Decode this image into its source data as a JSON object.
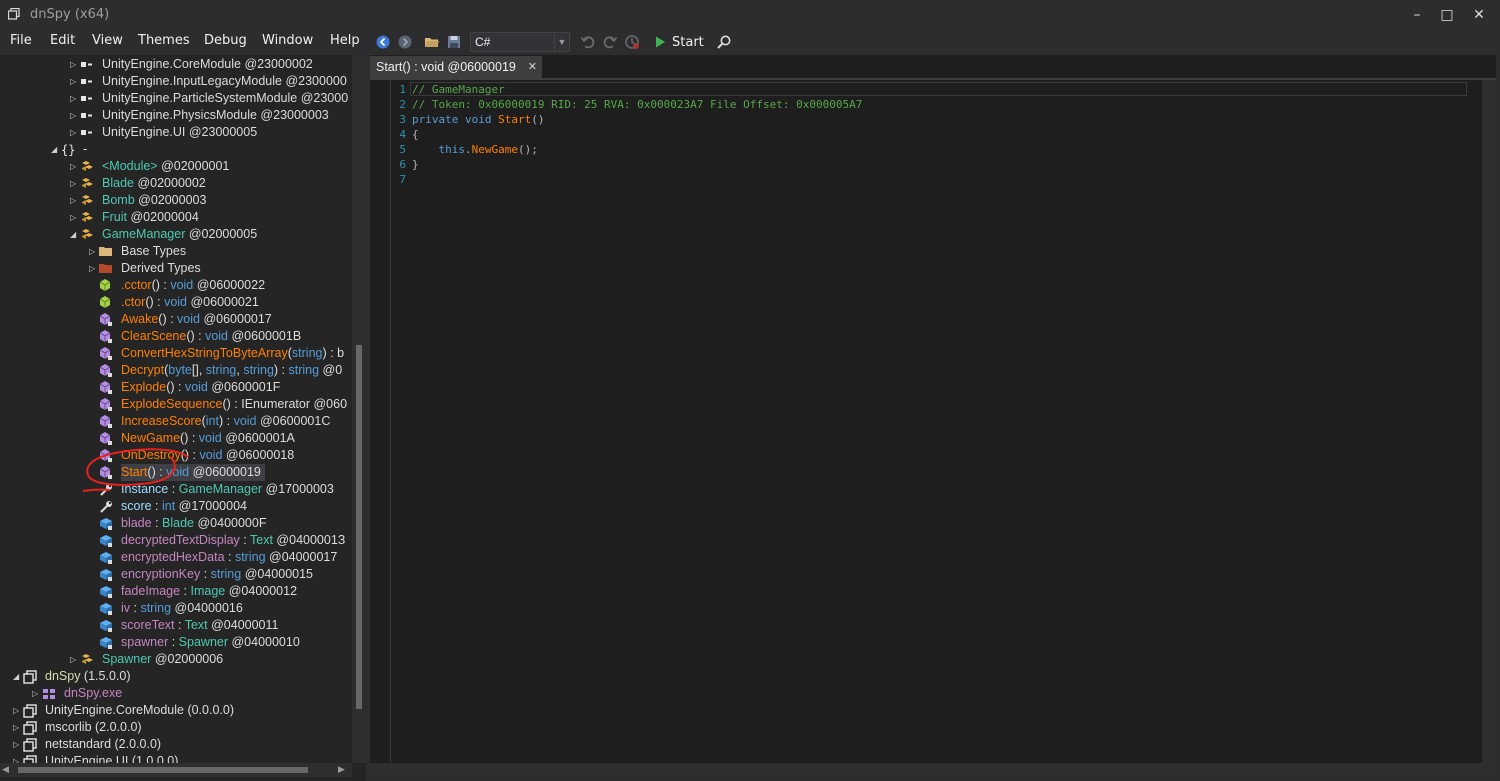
{
  "window": {
    "title": "dnSpy (x64)",
    "minimize": "–",
    "maximize": "□",
    "close": "✕"
  },
  "menu": [
    "File",
    "Edit",
    "View",
    "Themes",
    "Debug",
    "Window",
    "Help"
  ],
  "toolbar": {
    "language": "C#",
    "start_label": "Start",
    "icons": [
      "back-icon",
      "forward-icon",
      "open-icon",
      "save-icon",
      "undo-icon",
      "redo-icon",
      "break-icon",
      "start-icon",
      "search-icon"
    ]
  },
  "tree": [
    {
      "indent": 70,
      "arrow": "right",
      "icon": "reference",
      "parts": [
        {
          "t": "UnityEngine.CoreModule",
          "c": "white"
        },
        {
          "t": " @23000002",
          "c": "white"
        }
      ]
    },
    {
      "indent": 70,
      "arrow": "right",
      "icon": "reference",
      "parts": [
        {
          "t": "UnityEngine.InputLegacyModule",
          "c": "white"
        },
        {
          "t": " @2300000",
          "c": "white"
        }
      ]
    },
    {
      "indent": 70,
      "arrow": "right",
      "icon": "reference",
      "parts": [
        {
          "t": "UnityEngine.ParticleSystemModule",
          "c": "white"
        },
        {
          "t": " @23000",
          "c": "white"
        }
      ]
    },
    {
      "indent": 70,
      "arrow": "right",
      "icon": "reference",
      "parts": [
        {
          "t": "UnityEngine.PhysicsModule",
          "c": "white"
        },
        {
          "t": " @23000003",
          "c": "white"
        }
      ]
    },
    {
      "indent": 70,
      "arrow": "right",
      "icon": "reference",
      "parts": [
        {
          "t": "UnityEngine.UI",
          "c": "white"
        },
        {
          "t": " @23000005",
          "c": "white"
        }
      ]
    },
    {
      "indent": 51,
      "arrow": "down",
      "icon": "namespace",
      "parts": [
        {
          "t": "-",
          "c": "white"
        }
      ]
    },
    {
      "indent": 70,
      "arrow": "right",
      "icon": "class",
      "parts": [
        {
          "t": "<Module>",
          "c": "teal"
        },
        {
          "t": " @02000001",
          "c": "white"
        }
      ]
    },
    {
      "indent": 70,
      "arrow": "right",
      "icon": "class",
      "parts": [
        {
          "t": "Blade",
          "c": "teal"
        },
        {
          "t": " @02000002",
          "c": "white"
        }
      ]
    },
    {
      "indent": 70,
      "arrow": "right",
      "icon": "class",
      "parts": [
        {
          "t": "Bomb",
          "c": "teal"
        },
        {
          "t": " @02000003",
          "c": "white"
        }
      ]
    },
    {
      "indent": 70,
      "arrow": "right",
      "icon": "class",
      "parts": [
        {
          "t": "Fruit",
          "c": "teal"
        },
        {
          "t": " @02000004",
          "c": "white"
        }
      ]
    },
    {
      "indent": 70,
      "arrow": "down",
      "icon": "class",
      "parts": [
        {
          "t": "GameManager",
          "c": "teal"
        },
        {
          "t": " @02000005",
          "c": "white"
        }
      ]
    },
    {
      "indent": 89,
      "arrow": "right",
      "icon": "folder",
      "parts": [
        {
          "t": "Base Types",
          "c": "white"
        }
      ]
    },
    {
      "indent": 89,
      "arrow": "right",
      "icon": "folder-derived",
      "parts": [
        {
          "t": "Derived Types",
          "c": "white"
        }
      ]
    },
    {
      "indent": 89,
      "arrow": "",
      "icon": "method-public",
      "parts": [
        {
          "t": ".cctor",
          "c": "orange"
        },
        {
          "t": "()",
          "c": "white"
        },
        {
          "t": " : ",
          "c": "white"
        },
        {
          "t": "void",
          "c": "blue"
        },
        {
          "t": " @06000022",
          "c": "white"
        }
      ]
    },
    {
      "indent": 89,
      "arrow": "",
      "icon": "method-public",
      "parts": [
        {
          "t": ".ctor",
          "c": "orange"
        },
        {
          "t": "()",
          "c": "white"
        },
        {
          "t": " : ",
          "c": "white"
        },
        {
          "t": "void",
          "c": "blue"
        },
        {
          "t": " @06000021",
          "c": "white"
        }
      ]
    },
    {
      "indent": 89,
      "arrow": "",
      "icon": "method-private",
      "parts": [
        {
          "t": "Awake",
          "c": "orange"
        },
        {
          "t": "()",
          "c": "white"
        },
        {
          "t": " : ",
          "c": "white"
        },
        {
          "t": "void",
          "c": "blue"
        },
        {
          "t": " @06000017",
          "c": "white"
        }
      ]
    },
    {
      "indent": 89,
      "arrow": "",
      "icon": "method-private",
      "parts": [
        {
          "t": "ClearScene",
          "c": "orange"
        },
        {
          "t": "()",
          "c": "white"
        },
        {
          "t": " : ",
          "c": "white"
        },
        {
          "t": "void",
          "c": "blue"
        },
        {
          "t": " @0600001B",
          "c": "white"
        }
      ]
    },
    {
      "indent": 89,
      "arrow": "",
      "icon": "method-private",
      "parts": [
        {
          "t": "ConvertHexStringToByteArray",
          "c": "orange"
        },
        {
          "t": "(",
          "c": "white"
        },
        {
          "t": "string",
          "c": "blue"
        },
        {
          "t": ") : b",
          "c": "white"
        }
      ]
    },
    {
      "indent": 89,
      "arrow": "",
      "icon": "method-private",
      "parts": [
        {
          "t": "Decrypt",
          "c": "orange"
        },
        {
          "t": "(",
          "c": "white"
        },
        {
          "t": "byte",
          "c": "blue"
        },
        {
          "t": "[], ",
          "c": "white"
        },
        {
          "t": "string",
          "c": "blue"
        },
        {
          "t": ", ",
          "c": "white"
        },
        {
          "t": "string",
          "c": "blue"
        },
        {
          "t": ") : ",
          "c": "white"
        },
        {
          "t": "string",
          "c": "blue"
        },
        {
          "t": " @0",
          "c": "white"
        }
      ]
    },
    {
      "indent": 89,
      "arrow": "",
      "icon": "method-private",
      "parts": [
        {
          "t": "Explode",
          "c": "orange"
        },
        {
          "t": "()",
          "c": "white"
        },
        {
          "t": " : ",
          "c": "white"
        },
        {
          "t": "void",
          "c": "blue"
        },
        {
          "t": " @0600001F",
          "c": "white"
        }
      ]
    },
    {
      "indent": 89,
      "arrow": "",
      "icon": "method-private",
      "parts": [
        {
          "t": "ExplodeSequence",
          "c": "orange"
        },
        {
          "t": "()",
          "c": "white"
        },
        {
          "t": " : IEnumerator @060",
          "c": "white"
        }
      ]
    },
    {
      "indent": 89,
      "arrow": "",
      "icon": "method-private",
      "parts": [
        {
          "t": "IncreaseScore",
          "c": "orange"
        },
        {
          "t": "(",
          "c": "white"
        },
        {
          "t": "int",
          "c": "blue"
        },
        {
          "t": ")",
          "c": "white"
        },
        {
          "t": " : ",
          "c": "white"
        },
        {
          "t": "void",
          "c": "blue"
        },
        {
          "t": " @0600001C",
          "c": "white"
        }
      ]
    },
    {
      "indent": 89,
      "arrow": "",
      "icon": "method-private",
      "parts": [
        {
          "t": "NewGame",
          "c": "orange"
        },
        {
          "t": "()",
          "c": "white"
        },
        {
          "t": " : ",
          "c": "white"
        },
        {
          "t": "void",
          "c": "blue"
        },
        {
          "t": " @0600001A",
          "c": "white"
        }
      ]
    },
    {
      "indent": 89,
      "arrow": "",
      "icon": "method-private",
      "parts": [
        {
          "t": "OnDestroy",
          "c": "orange"
        },
        {
          "t": "()",
          "c": "white"
        },
        {
          "t": " : ",
          "c": "white"
        },
        {
          "t": "void",
          "c": "blue"
        },
        {
          "t": " @06000018",
          "c": "white"
        }
      ]
    },
    {
      "indent": 89,
      "arrow": "",
      "icon": "method-private",
      "selected": true,
      "parts": [
        {
          "t": "Start",
          "c": "orange"
        },
        {
          "t": "()",
          "c": "white"
        },
        {
          "t": " : ",
          "c": "white"
        },
        {
          "t": "void",
          "c": "blue"
        },
        {
          "t": " @06000019",
          "c": "white"
        }
      ]
    },
    {
      "indent": 89,
      "arrow": "",
      "icon": "property",
      "parts": [
        {
          "t": "Instance",
          "c": "lblue"
        },
        {
          "t": " : ",
          "c": "white"
        },
        {
          "t": "GameManager",
          "c": "teal"
        },
        {
          "t": " @17000003",
          "c": "white"
        }
      ]
    },
    {
      "indent": 89,
      "arrow": "",
      "icon": "property",
      "parts": [
        {
          "t": "score",
          "c": "lblue"
        },
        {
          "t": " : ",
          "c": "white"
        },
        {
          "t": "int",
          "c": "blue"
        },
        {
          "t": " @17000004",
          "c": "white"
        }
      ]
    },
    {
      "indent": 89,
      "arrow": "",
      "icon": "field",
      "parts": [
        {
          "t": "blade",
          "c": "purple"
        },
        {
          "t": " : ",
          "c": "white"
        },
        {
          "t": "Blade",
          "c": "teal"
        },
        {
          "t": " @0400000F",
          "c": "white"
        }
      ]
    },
    {
      "indent": 89,
      "arrow": "",
      "icon": "field",
      "parts": [
        {
          "t": "decryptedTextDisplay",
          "c": "purple"
        },
        {
          "t": " : ",
          "c": "white"
        },
        {
          "t": "Text",
          "c": "teal"
        },
        {
          "t": " @0400001З",
          "c": "white"
        }
      ]
    },
    {
      "indent": 89,
      "arrow": "",
      "icon": "field",
      "parts": [
        {
          "t": "encryptedHexData",
          "c": "purple"
        },
        {
          "t": " : ",
          "c": "white"
        },
        {
          "t": "string",
          "c": "blue"
        },
        {
          "t": " @04000017",
          "c": "white"
        }
      ]
    },
    {
      "indent": 89,
      "arrow": "",
      "icon": "field",
      "parts": [
        {
          "t": "encryptionKey",
          "c": "purple"
        },
        {
          "t": " : ",
          "c": "white"
        },
        {
          "t": "string",
          "c": "blue"
        },
        {
          "t": " @04000015",
          "c": "white"
        }
      ]
    },
    {
      "indent": 89,
      "arrow": "",
      "icon": "field",
      "parts": [
        {
          "t": "fadeImage",
          "c": "purple"
        },
        {
          "t": " : ",
          "c": "white"
        },
        {
          "t": "Image",
          "c": "teal"
        },
        {
          "t": " @04000012",
          "c": "white"
        }
      ]
    },
    {
      "indent": 89,
      "arrow": "",
      "icon": "field",
      "parts": [
        {
          "t": "iv",
          "c": "purple"
        },
        {
          "t": " : ",
          "c": "white"
        },
        {
          "t": "string",
          "c": "blue"
        },
        {
          "t": " @04000016",
          "c": "white"
        }
      ]
    },
    {
      "indent": 89,
      "arrow": "",
      "icon": "field",
      "parts": [
        {
          "t": "scoreText",
          "c": "purple"
        },
        {
          "t": " : ",
          "c": "white"
        },
        {
          "t": "Text",
          "c": "teal"
        },
        {
          "t": " @04000011",
          "c": "white"
        }
      ]
    },
    {
      "indent": 89,
      "arrow": "",
      "icon": "field",
      "parts": [
        {
          "t": "spawner",
          "c": "purple"
        },
        {
          "t": " : ",
          "c": "white"
        },
        {
          "t": "Spawner",
          "c": "teal"
        },
        {
          "t": " @04000010",
          "c": "white"
        }
      ]
    },
    {
      "indent": 70,
      "arrow": "right",
      "icon": "class",
      "parts": [
        {
          "t": "Spawner",
          "c": "teal"
        },
        {
          "t": " @02000006",
          "c": "white"
        }
      ]
    },
    {
      "indent": 13,
      "arrow": "down",
      "icon": "assembly",
      "parts": [
        {
          "t": "dnSpy",
          "c": "yellow"
        },
        {
          "t": " (1.5.0.0)",
          "c": "white"
        }
      ]
    },
    {
      "indent": 32,
      "arrow": "right",
      "icon": "module",
      "parts": [
        {
          "t": "dnSpy.exe",
          "c": "purple"
        }
      ]
    },
    {
      "indent": 13,
      "arrow": "right",
      "icon": "assembly",
      "parts": [
        {
          "t": "UnityEngine.CoreModule",
          "c": "white"
        },
        {
          "t": " (0.0.0.0)",
          "c": "white"
        }
      ]
    },
    {
      "indent": 13,
      "arrow": "right",
      "icon": "assembly",
      "parts": [
        {
          "t": "mscorlib",
          "c": "white"
        },
        {
          "t": " (2.0.0.0)",
          "c": "white"
        }
      ]
    },
    {
      "indent": 13,
      "arrow": "right",
      "icon": "assembly",
      "parts": [
        {
          "t": "netstandard",
          "c": "white"
        },
        {
          "t": " (2.0.0.0)",
          "c": "white"
        }
      ]
    },
    {
      "indent": 13,
      "arrow": "right",
      "icon": "assembly",
      "parts": [
        {
          "t": "UnityEngine.UI",
          "c": "white"
        },
        {
          "t": " (1.0.0.0)",
          "c": "white"
        }
      ]
    }
  ],
  "editor": {
    "tab_label": "Start() : void @06000019",
    "tab_close": "✕",
    "lines": [
      {
        "n": "1",
        "parts": [
          {
            "t": "// GameManager",
            "c": "comment"
          }
        ]
      },
      {
        "n": "2",
        "parts": [
          {
            "t": "// Token: 0x06000019 RID: 25 RVA: 0x000023A7 File Offset: 0x000005A7",
            "c": "comment"
          }
        ]
      },
      {
        "n": "3",
        "parts": [
          {
            "t": "private",
            "c": "kw"
          },
          {
            "t": " ",
            "c": "plain"
          },
          {
            "t": "void",
            "c": "kw"
          },
          {
            "t": " ",
            "c": "plain"
          },
          {
            "t": "Start",
            "c": "method"
          },
          {
            "t": "()",
            "c": "punc"
          }
        ]
      },
      {
        "n": "4",
        "parts": [
          {
            "t": "{",
            "c": "punc"
          }
        ]
      },
      {
        "n": "5",
        "parts": [
          {
            "t": "    ",
            "c": "plain"
          },
          {
            "t": "this",
            "c": "kw"
          },
          {
            "t": ".",
            "c": "punc"
          },
          {
            "t": "NewGame",
            "c": "method"
          },
          {
            "t": "();",
            "c": "punc"
          }
        ]
      },
      {
        "n": "6",
        "parts": [
          {
            "t": "}",
            "c": "punc"
          }
        ]
      },
      {
        "n": "7",
        "parts": []
      }
    ]
  },
  "colors": {
    "accent_red": "#e8211c",
    "class_teal": "#4ec9b0",
    "method_orange": "#ff8000",
    "keyword_blue": "#569cd6",
    "comment_green": "#57a64a"
  }
}
